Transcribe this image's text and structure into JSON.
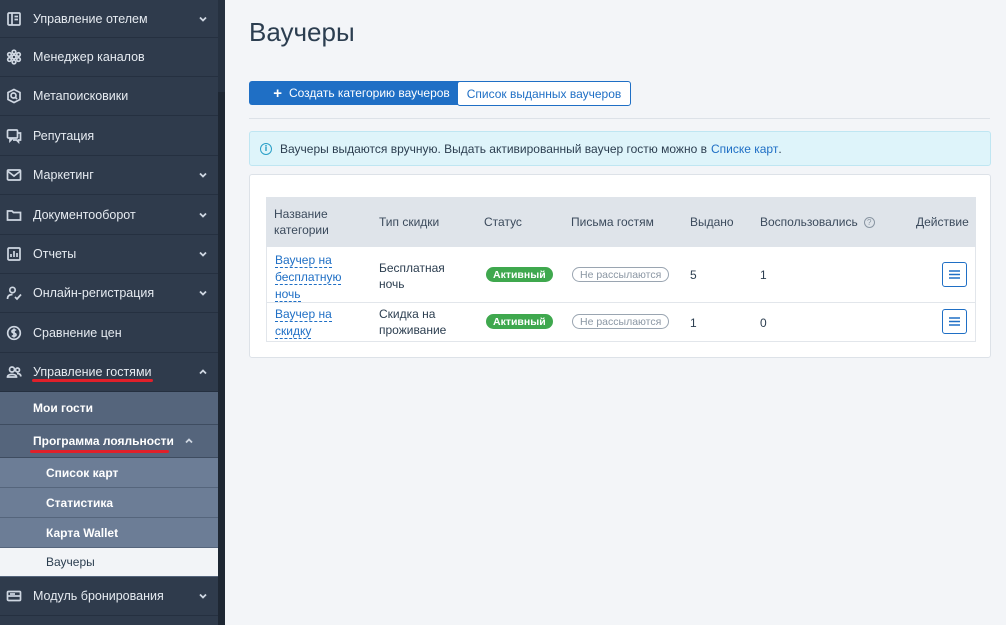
{
  "sidebar": {
    "items": [
      {
        "label": "Управление отелем",
        "icon": "hotel-icon"
      },
      {
        "label": "Менеджер каналов",
        "icon": "channels-icon"
      },
      {
        "label": "Метапоисковики",
        "icon": "meta-search-icon"
      },
      {
        "label": "Репутация",
        "icon": "reputation-icon"
      },
      {
        "label": "Маркетинг",
        "icon": "mail-icon"
      },
      {
        "label": "Документооборот",
        "icon": "folder-icon"
      },
      {
        "label": "Отчеты",
        "icon": "reports-icon"
      },
      {
        "label": "Онлайн-регистрация",
        "icon": "user-check-icon"
      },
      {
        "label": "Сравнение цен",
        "icon": "price-compare-icon"
      },
      {
        "label": "Управление гостями",
        "icon": "guests-icon"
      },
      {
        "label": "Модуль бронирования",
        "icon": "booking-icon"
      }
    ],
    "guest_sub": {
      "my_guests": "Мои гости",
      "loyalty": "Программа лояльности",
      "loyalty_items": [
        "Список карт",
        "Статистика",
        "Карта Wallet",
        "Ваучеры"
      ]
    }
  },
  "page": {
    "title": "Ваучеры",
    "create_button": "Создать категорию ваучеров",
    "list_button": "Список выданных ваучеров",
    "info_text": "Ваучеры выдаются вручную. Выдать активированный ваучер гостю можно в",
    "info_link": "Списке карт",
    "info_end": "."
  },
  "table": {
    "headers": {
      "name_line1": "Название",
      "name_line2": "категории",
      "type": "Тип скидки",
      "status": "Статус",
      "letters": "Письма гостям",
      "issued": "Выдано",
      "used": "Воспользовались",
      "action": "Действие"
    },
    "rows": [
      {
        "name": [
          "Ваучер на",
          "бесплатную",
          "ночь"
        ],
        "type": [
          "Бесплатная",
          "ночь"
        ],
        "status": "Активный",
        "letters": "Не рассылаются",
        "issued": "5",
        "used": "1"
      },
      {
        "name": [
          "Ваучер на",
          "скидку"
        ],
        "type": [
          "Скидка на",
          "проживание"
        ],
        "status": "Активный",
        "letters": "Не рассылаются",
        "issued": "1",
        "used": "0"
      }
    ]
  }
}
